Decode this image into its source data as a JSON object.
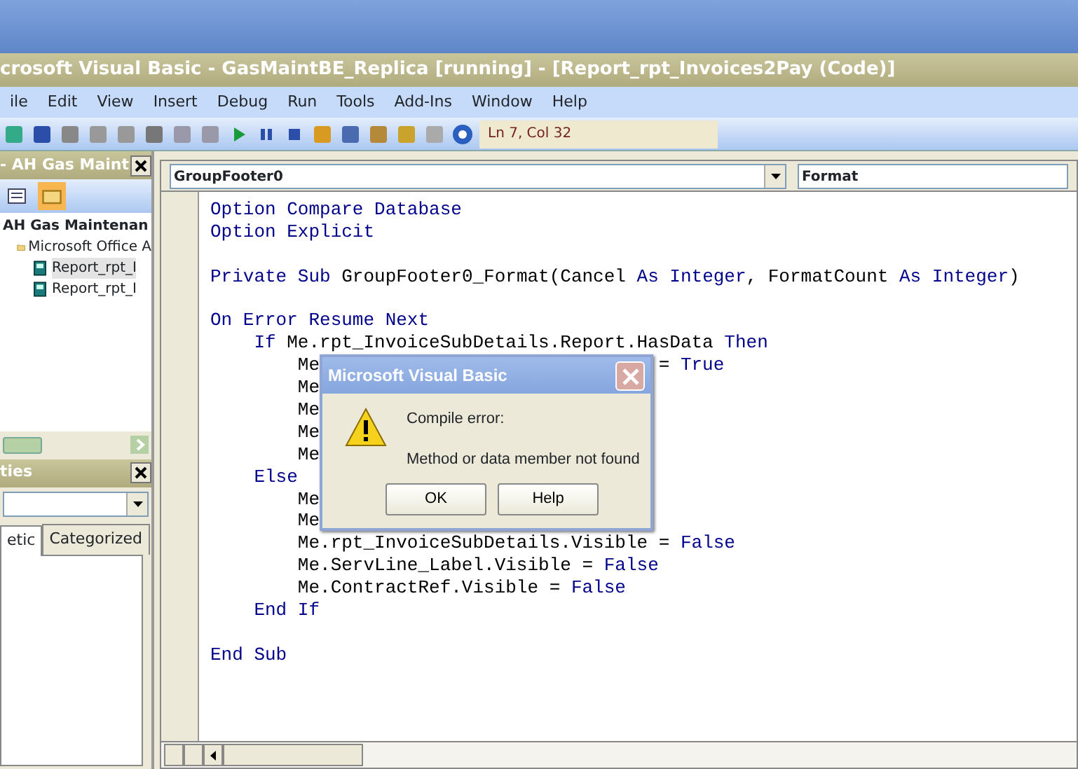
{
  "window": {
    "title": "crosoft Visual Basic - GasMaintBE_Replica [running] - [Report_rpt_Invoices2Pay (Code)]"
  },
  "menu": [
    "ile",
    "Edit",
    "View",
    "Insert",
    "Debug",
    "Run",
    "Tools",
    "Add-Ins",
    "Window",
    "Help"
  ],
  "toolbar": {
    "position": "Ln 7, Col 32"
  },
  "project": {
    "title": "- AH Gas Maint",
    "tree": [
      {
        "label": "AH Gas Maintenan",
        "kind": "project",
        "children": [
          {
            "label": "Microsoft Office A",
            "kind": "folder",
            "children": [
              {
                "label": "Report_rpt_I",
                "kind": "module",
                "selected": true
              },
              {
                "label": "Report_rpt_I",
                "kind": "module",
                "selected": false
              }
            ]
          }
        ]
      }
    ]
  },
  "properties": {
    "title": "ties",
    "tabs": [
      {
        "label": "etic",
        "selected": true
      },
      {
        "label": "Categorized",
        "selected": false
      }
    ]
  },
  "code": {
    "object": "GroupFooter0",
    "procedure": "Format",
    "lines": [
      {
        "tokens": [
          {
            "t": "Option Compare Database",
            "kind": "keyword"
          }
        ]
      },
      {
        "tokens": [
          {
            "t": "Option Explicit",
            "kind": "keyword"
          }
        ]
      },
      {
        "gap_before": true,
        "tokens": [
          {
            "t": "Private Sub",
            "kind": "keyword"
          },
          {
            "t": " GroupFooter0_Format(Cancel ",
            "kind": "plain"
          },
          {
            "t": "As Integer",
            "kind": "keyword"
          },
          {
            "t": ", FormatCount ",
            "kind": "plain"
          },
          {
            "t": "As Integer",
            "kind": "keyword"
          },
          {
            "t": ")",
            "kind": "plain"
          }
        ]
      },
      {
        "gap_before": true,
        "tokens": [
          {
            "t": "On Error Resume Next",
            "kind": "keyword"
          }
        ]
      },
      {
        "tokens": [
          {
            "t": "    If",
            "kind": "keyword"
          },
          {
            "t": " Me.rpt_InvoiceSubDetails.Report.HasData ",
            "kind": "plain"
          },
          {
            "t": "Then",
            "kind": "keyword"
          }
        ]
      },
      {
        "tokens": [
          {
            "t": "        Me",
            "kind": "plain"
          },
          {
            "t": "= ",
            "kind": "tail"
          },
          {
            "t": "True",
            "kind": "tailkey"
          }
        ]
      },
      {
        "tokens": [
          {
            "t": "        Me",
            "kind": "plain"
          }
        ]
      },
      {
        "tokens": [
          {
            "t": "        Me",
            "kind": "plain"
          }
        ]
      },
      {
        "tokens": [
          {
            "t": "        Me",
            "kind": "plain"
          }
        ]
      },
      {
        "tokens": [
          {
            "t": "        Me",
            "kind": "plain"
          }
        ]
      },
      {
        "tokens": [
          {
            "t": "    Else",
            "kind": "keyword"
          }
        ]
      },
      {
        "tokens": [
          {
            "t": "        Me",
            "kind": "plain"
          }
        ]
      },
      {
        "tokens": [
          {
            "t": "        Me",
            "kind": "plain"
          }
        ]
      },
      {
        "tokens": [
          {
            "t": "        Me.rpt_InvoiceSubDetails.Visible = ",
            "kind": "plain"
          },
          {
            "t": "False",
            "kind": "keyword"
          }
        ]
      },
      {
        "tokens": [
          {
            "t": "        Me.ServLine_Label.Visible = ",
            "kind": "plain"
          },
          {
            "t": "False",
            "kind": "keyword"
          }
        ]
      },
      {
        "tokens": [
          {
            "t": "        Me.ContractRef.Visible = ",
            "kind": "plain"
          },
          {
            "t": "False",
            "kind": "keyword"
          }
        ]
      },
      {
        "tokens": [
          {
            "t": "    End If",
            "kind": "keyword"
          }
        ]
      },
      {
        "gap_before": true,
        "tokens": [
          {
            "t": "End Sub",
            "kind": "keyword"
          }
        ]
      }
    ]
  },
  "dialog": {
    "title": "Microsoft Visual Basic",
    "heading": "Compile error:",
    "message": "Method or data member not found",
    "buttons": [
      "OK",
      "Help"
    ]
  }
}
